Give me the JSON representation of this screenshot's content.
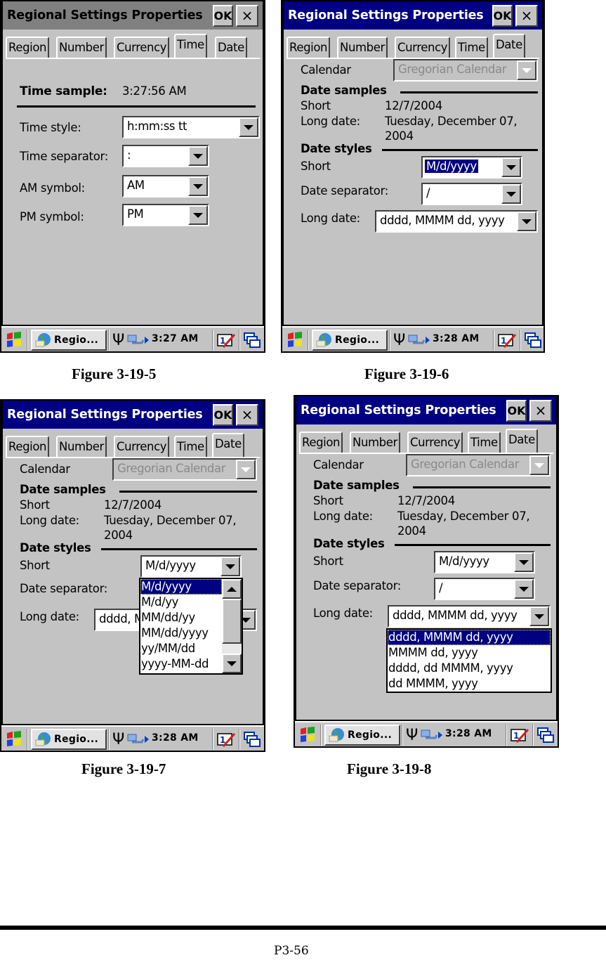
{
  "figures": [
    {
      "caption": "Figure 3-19-5",
      "window": {
        "title": "Regional Settings Properties",
        "ok_label": "OK",
        "close_label": "×",
        "title_state": "inactive"
      },
      "tabs": [
        "Region",
        "Number",
        "Currency",
        "Time",
        "Date"
      ],
      "selected_tab": "Time",
      "time_sample_label": "Time sample:",
      "time_sample_value": "3:27:56 AM",
      "fields": [
        {
          "label": "Time style:",
          "value": "h:mm:ss tt"
        },
        {
          "label": "Time separator:",
          "value": ":"
        },
        {
          "label": "AM symbol:",
          "value": "AM"
        },
        {
          "label": "PM symbol:",
          "value": "PM"
        }
      ],
      "taskbar": {
        "app_label": "Regio...",
        "clock": "3:27 AM"
      }
    },
    {
      "caption": "Figure 3-19-6",
      "window": {
        "title": "Regional Settings Properties",
        "ok_label": "OK",
        "close_label": "×",
        "title_state": "active"
      },
      "tabs": [
        "Region",
        "Number",
        "Currency",
        "Time",
        "Date"
      ],
      "selected_tab": "Date",
      "calendar_label": "Calendar",
      "calendar_value": "Gregorian Calendar",
      "samples_heading": "Date samples",
      "short_label": "Short",
      "short_sample": "12/7/2004",
      "long_label": "Long date:",
      "long_sample_line1": "Tuesday, December 07,",
      "long_sample_line2": "2004",
      "styles_heading": "Date styles",
      "short_style_label": "Short",
      "short_style_value": "M/d/yyyy",
      "separator_label": "Date separator:",
      "separator_value": "/",
      "long_style_label": "Long date:",
      "long_style_value": "dddd, MMMM dd, yyyy",
      "taskbar": {
        "app_label": "Regio...",
        "clock": "3:28 AM"
      }
    },
    {
      "caption": "Figure 3-19-7",
      "window": {
        "title": "Regional Settings Properties",
        "ok_label": "OK",
        "close_label": "×",
        "title_state": "active"
      },
      "tabs": [
        "Region",
        "Number",
        "Currency",
        "Time",
        "Date"
      ],
      "selected_tab": "Date",
      "calendar_label": "Calendar",
      "calendar_value": "Gregorian Calendar",
      "samples_heading": "Date samples",
      "short_label": "Short",
      "short_sample": "12/7/2004",
      "long_label": "Long date:",
      "long_sample_line1": "Tuesday, December 07,",
      "long_sample_line2": "2004",
      "styles_heading": "Date styles",
      "short_style_label": "Short",
      "short_style_value": "M/d/yyyy",
      "separator_label": "Date separator:",
      "long_style_label": "Long date:",
      "long_style_value_partial": "dddd, M",
      "short_dropdown_options": [
        "M/d/yyyy",
        "M/d/yy",
        "MM/dd/yy",
        "MM/dd/yyyy",
        "yy/MM/dd",
        "yyyy-MM-dd"
      ],
      "short_dropdown_selected": "M/d/yyyy",
      "taskbar": {
        "app_label": "Regio...",
        "clock": "3:28 AM"
      }
    },
    {
      "caption": "Figure 3-19-8",
      "window": {
        "title": "Regional Settings Properties",
        "ok_label": "OK",
        "close_label": "×",
        "title_state": "active"
      },
      "tabs": [
        "Region",
        "Number",
        "Currency",
        "Time",
        "Date"
      ],
      "selected_tab": "Date",
      "calendar_label": "Calendar",
      "calendar_value": "Gregorian Calendar",
      "samples_heading": "Date samples",
      "short_label": "Short",
      "short_sample": "12/7/2004",
      "long_label": "Long date:",
      "long_sample_line1": "Tuesday, December 07,",
      "long_sample_line2": "2004",
      "styles_heading": "Date styles",
      "short_style_label": "Short",
      "short_style_value": "M/d/yyyy",
      "separator_label": "Date separator:",
      "separator_value": "/",
      "long_style_label": "Long date:",
      "long_style_value": "dddd, MMMM dd, yyyy",
      "long_dropdown_options": [
        "dddd, MMMM dd, yyyy",
        "MMMM dd, yyyy",
        "dddd, dd MMMM, yyyy",
        "dd MMMM, yyyy"
      ],
      "long_dropdown_selected": "dddd, MMMM dd, yyyy",
      "taskbar": {
        "app_label": "Regio...",
        "clock": "3:28 AM"
      }
    }
  ],
  "icons": {
    "start": "windows-flag-icon",
    "app": "globe-icon",
    "signal": "antenna-icon",
    "network": "network-connection-icon",
    "tray_arrow": "right-arrow-icon",
    "input": "input-panel-icon",
    "desktop": "switch-windows-icon"
  },
  "colors": {
    "active_title": "#000080",
    "inactive_title": "#808080",
    "face": "#c3c3c3",
    "highlight": "#000080"
  },
  "page_number": "P3-56"
}
